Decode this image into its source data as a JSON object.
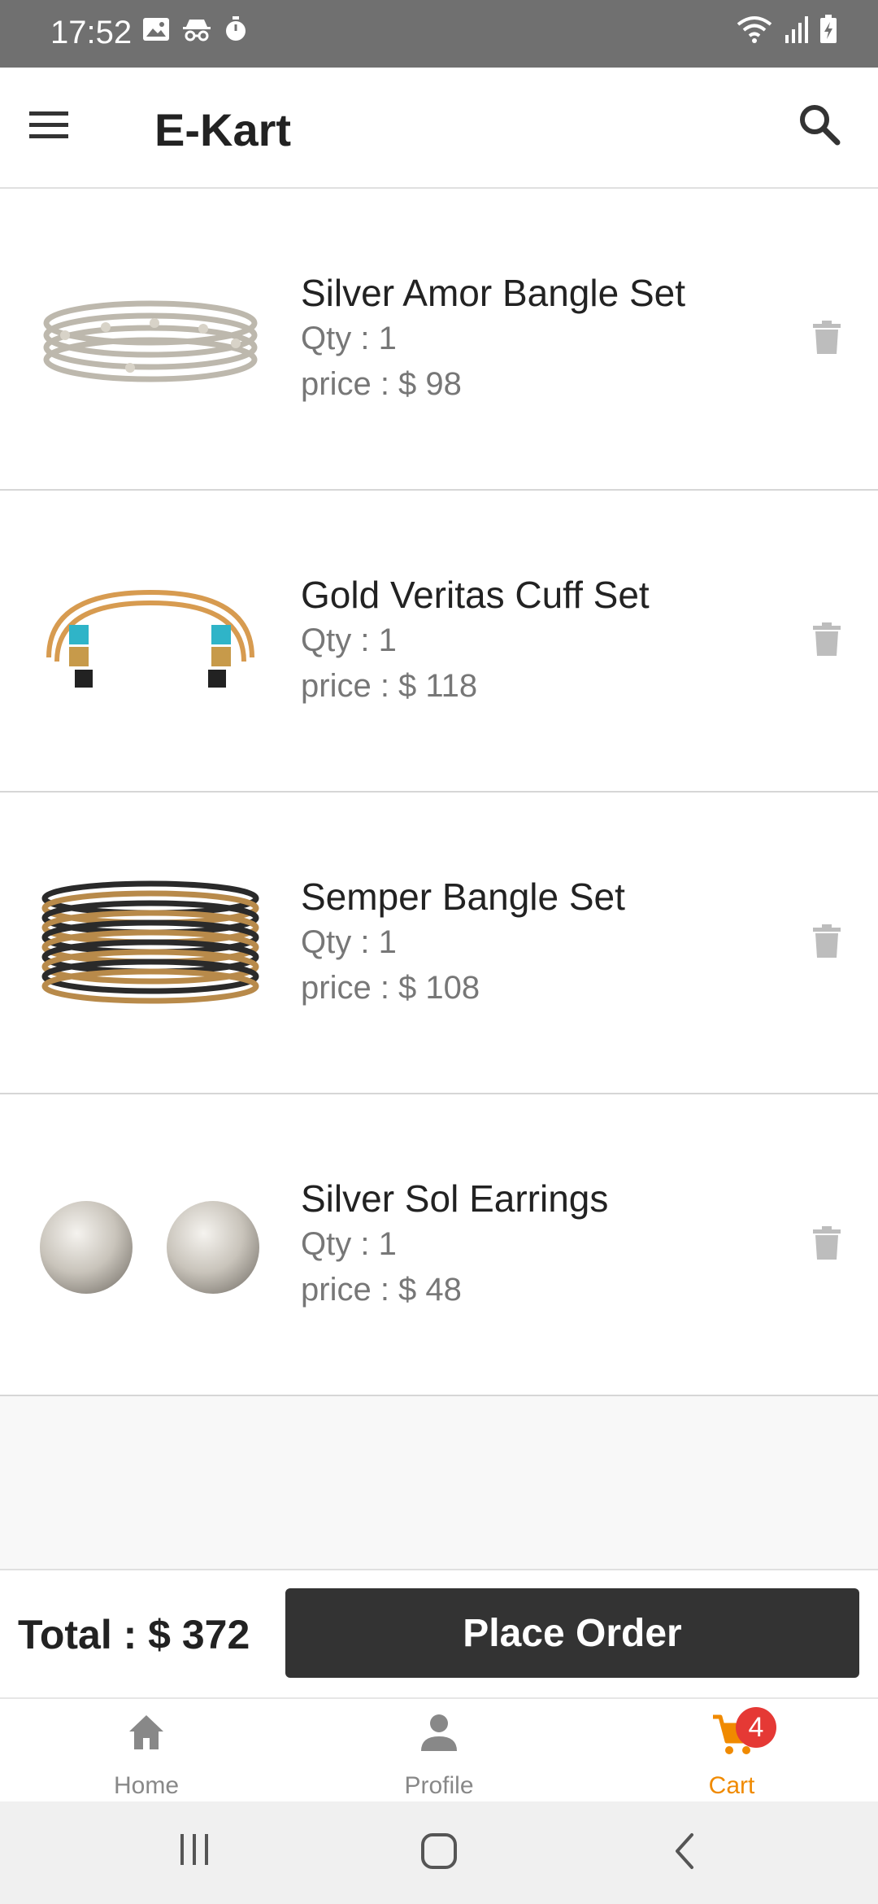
{
  "status": {
    "time": "17:52"
  },
  "app": {
    "title": "E-Kart"
  },
  "items": [
    {
      "name": "Silver Amor Bangle Set",
      "qty": "Qty : 1",
      "price": "price : $ 98"
    },
    {
      "name": "Gold Veritas Cuff Set",
      "qty": "Qty : 1",
      "price": "price : $ 118"
    },
    {
      "name": "Semper Bangle Set",
      "qty": "Qty : 1",
      "price": "price : $ 108"
    },
    {
      "name": "Silver Sol Earrings",
      "qty": "Qty : 1",
      "price": "price : $ 48"
    }
  ],
  "order": {
    "total": "Total : $ 372",
    "button": "Place Order"
  },
  "nav": {
    "home": "Home",
    "profile": "Profile",
    "cart": "Cart",
    "cart_badge": "4"
  },
  "colors": {
    "accent": "#f08a00",
    "badge": "#e53935",
    "button": "#333333",
    "statusbar": "#707070"
  },
  "icons": [
    "menu-icon",
    "search-icon",
    "delete-icon",
    "home-icon",
    "profile-icon",
    "cart-icon"
  ]
}
